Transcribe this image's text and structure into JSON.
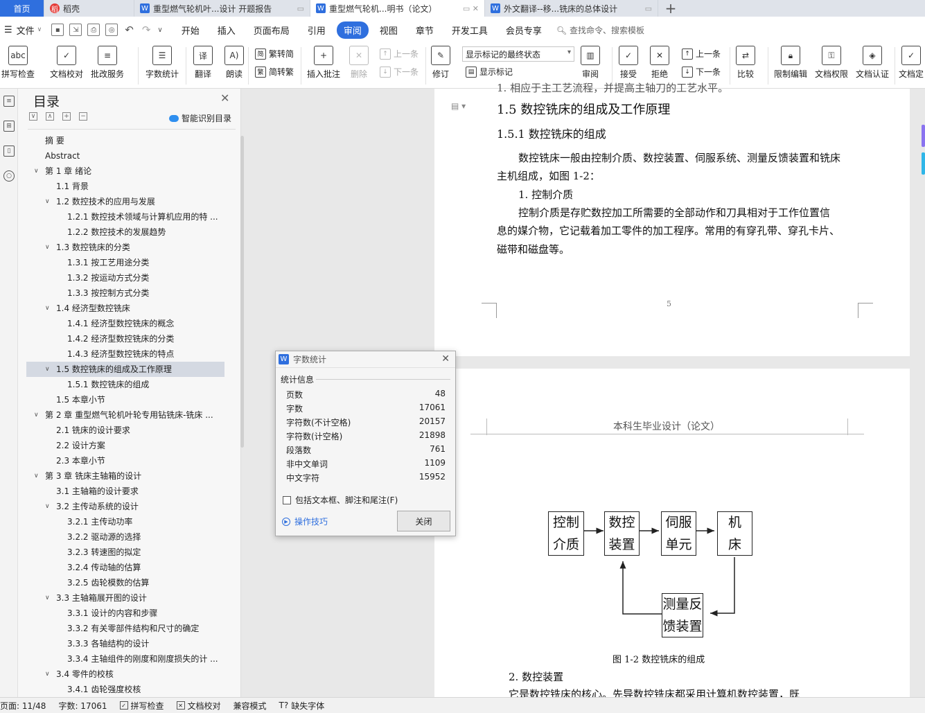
{
  "tabs": [
    {
      "label": "首页",
      "type": "home"
    },
    {
      "label": "稻壳",
      "type": "docer"
    },
    {
      "label": "重型燃气轮机叶...设计 开题报告",
      "type": "doc"
    },
    {
      "label": "重型燃气轮机...明书（论文）",
      "type": "doc",
      "active": true
    },
    {
      "label": "外文翻译--移...铣床的总体设计",
      "type": "doc"
    }
  ],
  "menubar": {
    "file_label": "文件",
    "items": [
      "开始",
      "插入",
      "页面布局",
      "引用",
      "审阅",
      "视图",
      "章节",
      "开发工具",
      "会员专享"
    ],
    "active": "审阅",
    "search_placeholder": "查找命令、搜索模板"
  },
  "ribbon": {
    "spell_check": "拼写检查",
    "doc_proof": "文档校对",
    "batch_service": "批改服务",
    "word_count": "字数统计",
    "translate": "翻译",
    "read_aloud": "朗读",
    "trad_simp": "繁转简",
    "simp_trad": "简转繁",
    "insert_comment": "插入批注",
    "delete": "删除",
    "prev": "上一条",
    "next": "下一条",
    "track_changes": "修订",
    "markup_state": "显示标记的最终状态",
    "show_markup": "显示标记",
    "review": "审阅",
    "accept": "接受",
    "reject": "拒绝",
    "prev2": "上一条",
    "next2": "下一条",
    "compare": "比较",
    "restrict_edit": "限制编辑",
    "doc_permission": "文档权限",
    "doc_cert": "文档认证",
    "doc_final": "文档定"
  },
  "toc": {
    "title": "目录",
    "smart_label": "智能识别目录",
    "items": [
      {
        "level": 1,
        "label": "摘  要",
        "arrow": false
      },
      {
        "level": 1,
        "label": "Abstract",
        "arrow": false
      },
      {
        "level": 1,
        "label": "第 1 章    绪论",
        "arrow": true
      },
      {
        "level": 2,
        "label": "1.1  背景",
        "arrow": false
      },
      {
        "level": 2,
        "label": "1.2  数控技术的应用与发展",
        "arrow": true
      },
      {
        "level": 3,
        "label": "1.2.1  数控技术领域与计算机应用的特 ...",
        "arrow": false
      },
      {
        "level": 3,
        "label": "1.2.2  数控技术的发展趋势",
        "arrow": false
      },
      {
        "level": 2,
        "label": "1.3  数控铣床的分类",
        "arrow": true
      },
      {
        "level": 3,
        "label": "1.3.1  按工艺用途分类",
        "arrow": false
      },
      {
        "level": 3,
        "label": "1.3.2  按运动方式分类",
        "arrow": false
      },
      {
        "level": 3,
        "label": "1.3.3  按控制方式分类",
        "arrow": false
      },
      {
        "level": 2,
        "label": "1.4  经济型数控铣床",
        "arrow": true
      },
      {
        "level": 3,
        "label": "1.4.1  经济型数控铣床的概念",
        "arrow": false
      },
      {
        "level": 3,
        "label": "1.4.2  经济型数控铣床的分类",
        "arrow": false
      },
      {
        "level": 3,
        "label": "1.4.3  经济型数控铣床的特点",
        "arrow": false
      },
      {
        "level": 2,
        "label": "1.5  数控铣床的组成及工作原理",
        "arrow": true,
        "selected": true
      },
      {
        "level": 3,
        "label": "1.5.1  数控铣床的组成",
        "arrow": false
      },
      {
        "level": 2,
        "label": "1.5  本章小节",
        "arrow": false
      },
      {
        "level": 1,
        "label": "第 2 章  重型燃气轮机叶轮专用钻铣床-铣床 ...",
        "arrow": true
      },
      {
        "level": 2,
        "label": "2.1  铣床的设计要求",
        "arrow": false
      },
      {
        "level": 2,
        "label": "2.2  设计方案",
        "arrow": false
      },
      {
        "level": 2,
        "label": "2.3  本章小节",
        "arrow": false
      },
      {
        "level": 1,
        "label": "第 3 章  铣床主轴箱的设计",
        "arrow": true
      },
      {
        "level": 2,
        "label": "3.1  主轴箱的设计要求",
        "arrow": false
      },
      {
        "level": 2,
        "label": "3.2 主传动系统的设计",
        "arrow": true
      },
      {
        "level": 3,
        "label": "3.2.1  主传动功率",
        "arrow": false
      },
      {
        "level": 3,
        "label": "3.2.2  驱动源的选择",
        "arrow": false
      },
      {
        "level": 3,
        "label": "3.2.3  转速图的拟定",
        "arrow": false
      },
      {
        "level": 3,
        "label": "3.2.4 传动轴的估算",
        "arrow": false
      },
      {
        "level": 3,
        "label": "3.2.5 齿轮模数的估算",
        "arrow": false
      },
      {
        "level": 2,
        "label": "3.3 主轴箱展开图的设计",
        "arrow": true
      },
      {
        "level": 3,
        "label": "3.3.1 设计的内容和步骤",
        "arrow": false
      },
      {
        "level": 3,
        "label": "3.3.2  有关零部件结构和尺寸的确定",
        "arrow": false
      },
      {
        "level": 3,
        "label": "3.3.3  各轴结构的设计",
        "arrow": false
      },
      {
        "level": 3,
        "label": "3.3.4  主轴组件的刚度和刚度损失的计 ...",
        "arrow": false
      },
      {
        "level": 2,
        "label": "3.4  零件的校核",
        "arrow": true
      },
      {
        "level": 3,
        "label": "3.4.1 齿轮强度校核",
        "arrow": false
      }
    ]
  },
  "document": {
    "top_cut_line": "1. 相应于主工艺流程，并提高主轴刀的工艺水平。",
    "heading_15": "1.5  数控铣床的组成及工作原理",
    "heading_151": "1.5.1  数控铣床的组成",
    "para1_line1": "数控铣床一般由控制介质、数控装置、伺服系统、测量反馈装置和铣床",
    "para1_line2": "主机组成，如图 1-2：",
    "item1": "1. 控制介质",
    "para2_line1": "控制介质是存贮数控加工所需要的全部动作和刀具相对于工作位置信",
    "para2_line2": "息的媒介物，它记载着加工零件的加工程序。常用的有穿孔带、穿孔卡片、",
    "para2_line3": "磁带和磁盘等。",
    "page_number": "5",
    "header_text": "本科生毕业设计（论文）",
    "diagram": {
      "box1": "控制\n介质",
      "box2": "数控\n装置",
      "box3": "伺服\n单元",
      "box4": "机\n床",
      "box5": "测量反\n馈装置",
      "caption": "图 1-2 数控铣床的组成"
    },
    "item2": "2. 数控装置",
    "bottom_cut_line": "它是数控铣床的核心。先导数控铣床都采用计算机数控装置，既"
  },
  "dialog": {
    "title": "字数统计",
    "section": "统计信息",
    "stats": [
      {
        "label": "页数",
        "value": "48"
      },
      {
        "label": "字数",
        "value": "17061"
      },
      {
        "label": "字符数(不计空格)",
        "value": "20157"
      },
      {
        "label": "字符数(计空格)",
        "value": "21898"
      },
      {
        "label": "段落数",
        "value": "761"
      },
      {
        "label": "非中文单词",
        "value": "1109"
      },
      {
        "label": "中文字符",
        "value": "15952"
      }
    ],
    "checkbox_label": "包括文本框、脚注和尾注(F)",
    "tips_label": "操作技巧",
    "close_label": "关闭"
  },
  "statusbar": {
    "page": "页面: 11/48",
    "words": "字数: 17061",
    "spell": "拼写检查",
    "proof": "文档校对",
    "compat": "兼容模式",
    "missing_font": "缺失字体"
  }
}
